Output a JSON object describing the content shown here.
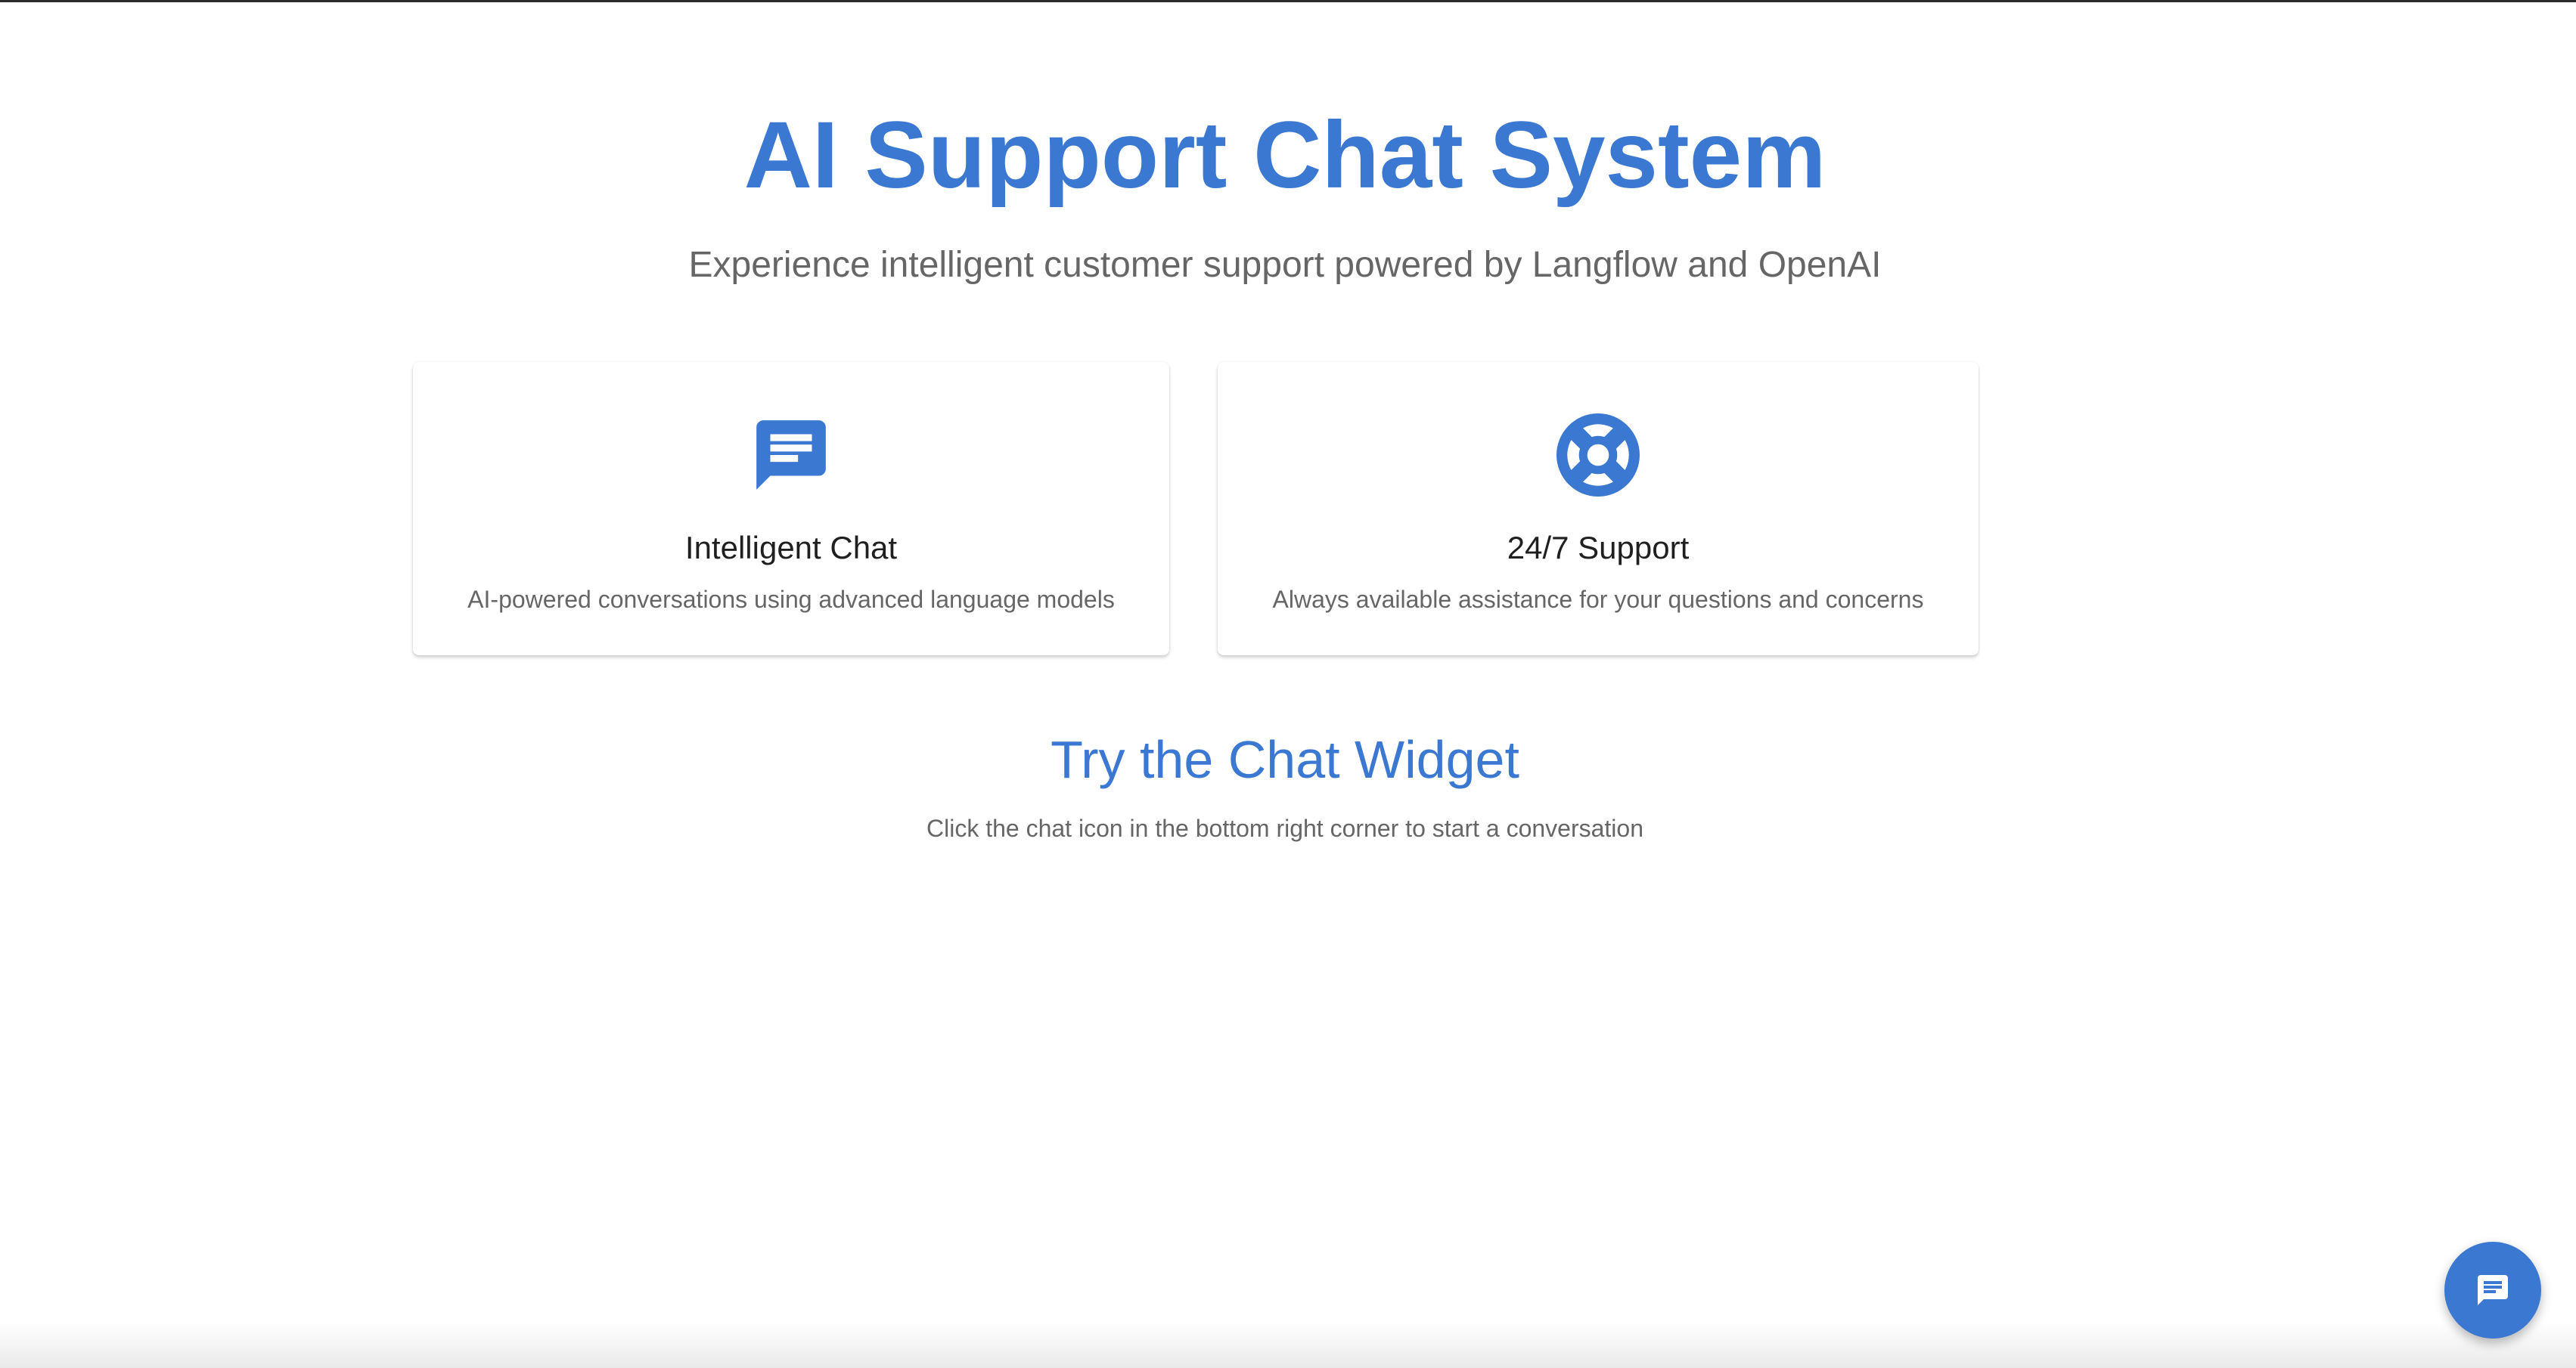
{
  "hero": {
    "title": "AI Support Chat System",
    "subtitle": "Experience intelligent customer support powered by Langflow and OpenAI"
  },
  "features": [
    {
      "icon": "chat-bubble-icon",
      "title": "Intelligent Chat",
      "description": "AI-powered conversations using advanced language models"
    },
    {
      "icon": "lifebuoy-icon",
      "title": "24/7 Support",
      "description": "Always available assistance for your questions and concerns"
    }
  ],
  "try_section": {
    "title": "Try the Chat Widget",
    "description": "Click the chat icon in the bottom right corner to start a conversation"
  },
  "chat_widget": {
    "icon": "chat-bubble-icon"
  },
  "colors": {
    "accent": "#3a78d1",
    "muted_text": "#666666",
    "heading_text": "#1f1f1f"
  }
}
